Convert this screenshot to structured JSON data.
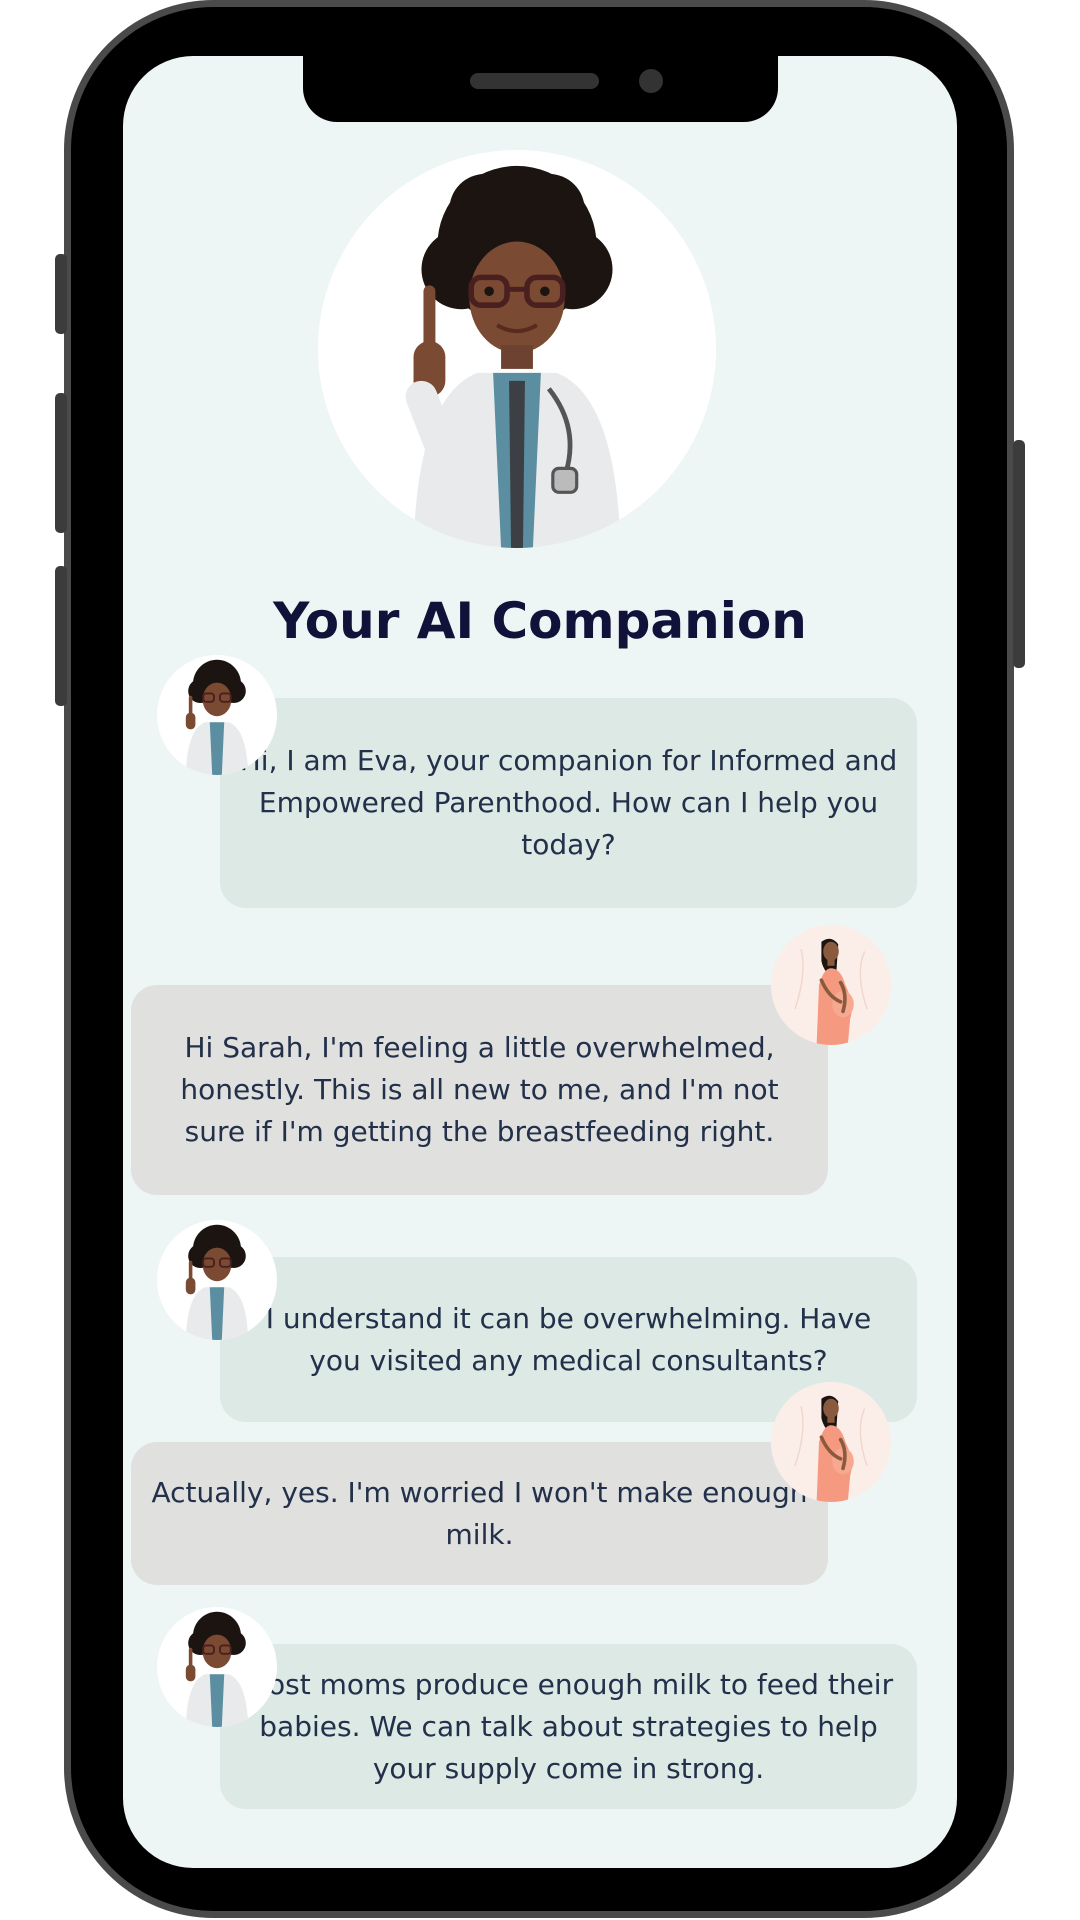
{
  "header": {
    "title": "Your AI Companion"
  },
  "icons": {
    "hero": "doctor-avatar-icon",
    "assistant": "doctor-avatar-icon",
    "user": "pregnant-woman-avatar-icon"
  },
  "colors": {
    "screen_bg": "#eef5f5",
    "assistant_bubble": "#dce9e5",
    "user_bubble": "#e0e0df",
    "title_text": "#10123a"
  },
  "messages": [
    {
      "sender": "assistant",
      "text": "Hi, I am Eva, your companion for Informed and Empowered Parenthood. How can I help you today?"
    },
    {
      "sender": "user",
      "text": "Hi Sarah, I'm feeling a little overwhelmed, honestly. This is all new to me, and I'm not sure if I'm getting the breastfeeding right."
    },
    {
      "sender": "assistant",
      "text": "I understand it can be overwhelming. Have you visited any medical consultants?"
    },
    {
      "sender": "user",
      "text": "Actually, yes. I'm worried I won't make enough milk."
    },
    {
      "sender": "assistant",
      "text": "Most moms produce enough milk to feed their babies. We can talk about strategies to help your supply come in strong."
    }
  ]
}
